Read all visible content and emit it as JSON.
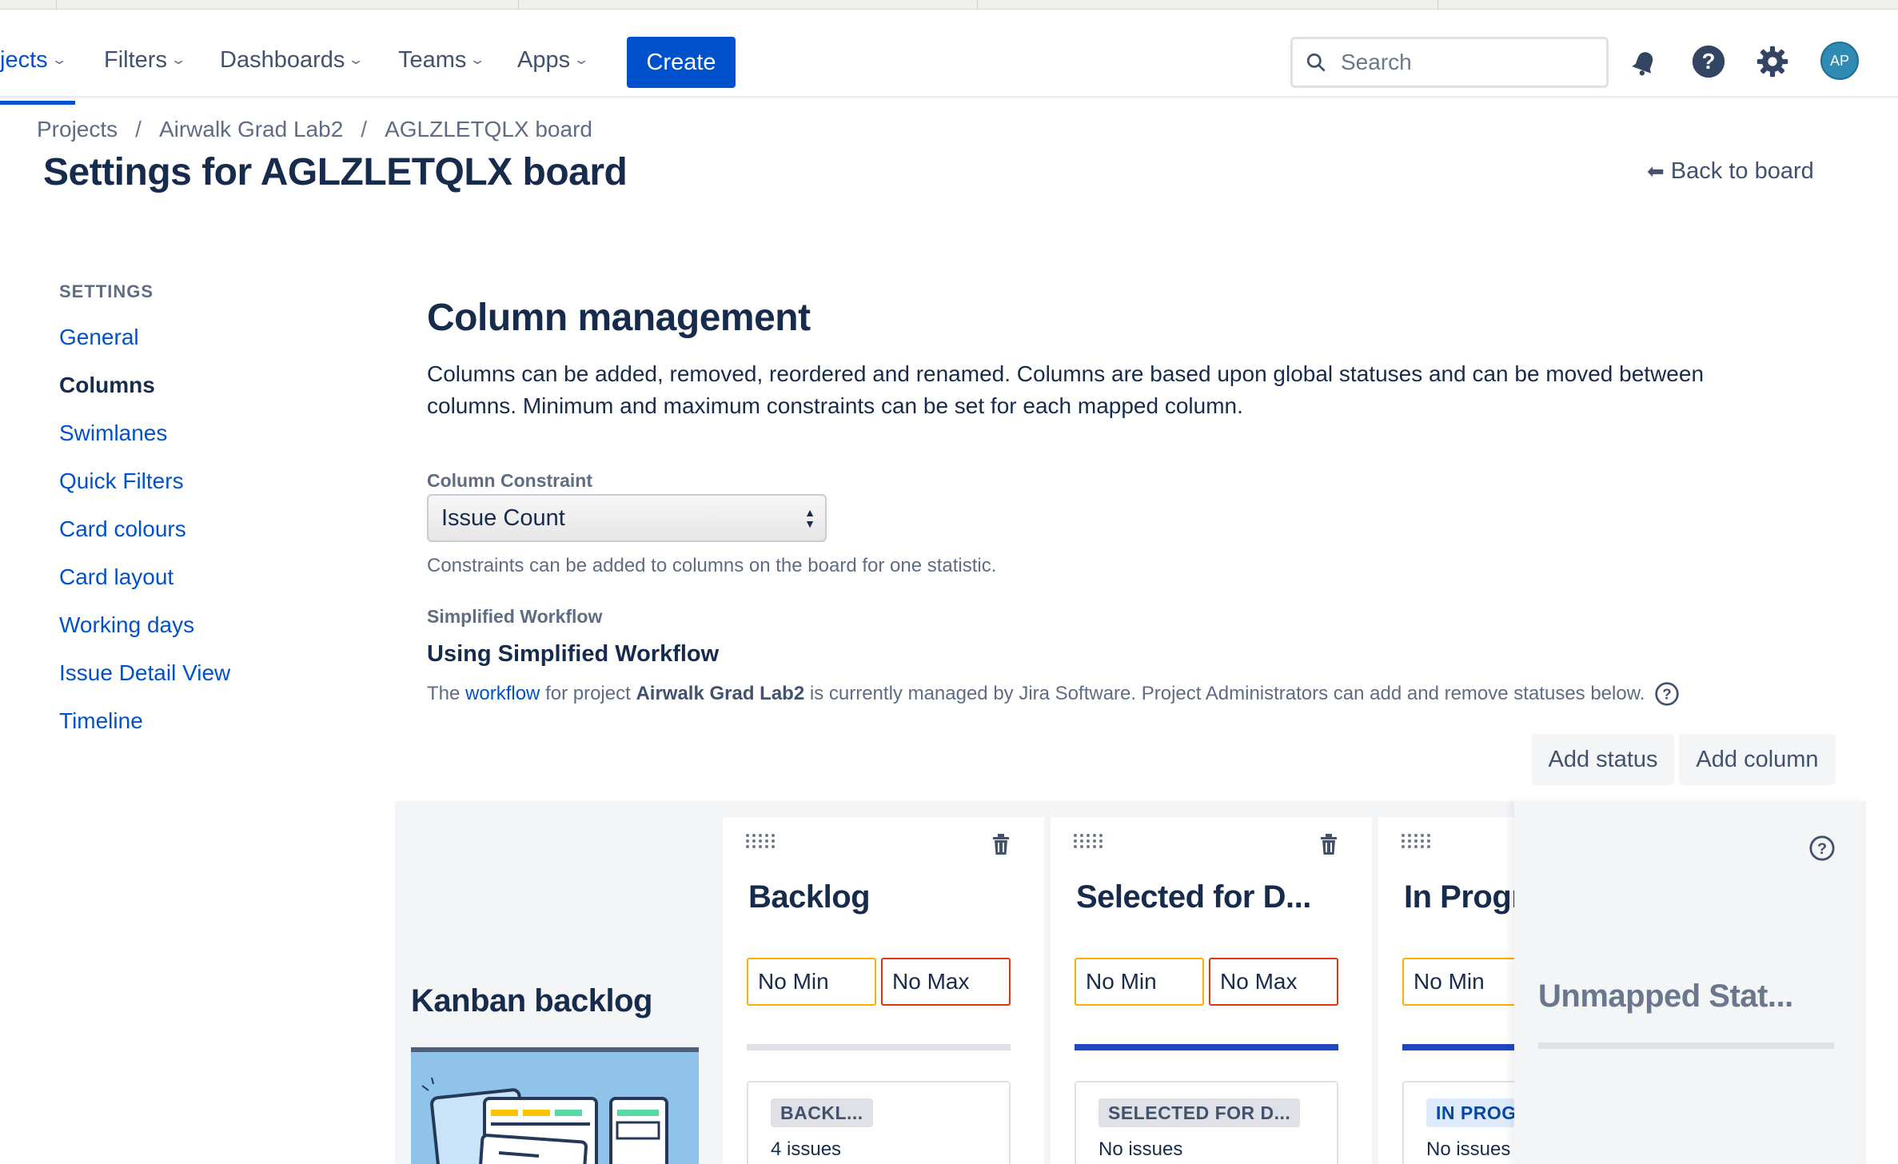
{
  "nav": {
    "items": [
      {
        "label": "jects",
        "active": true
      },
      {
        "label": "Filters"
      },
      {
        "label": "Dashboards"
      },
      {
        "label": "Teams"
      },
      {
        "label": "Apps"
      }
    ],
    "create_label": "Create",
    "search_placeholder": "Search",
    "avatar_initials": "AP",
    "icons": [
      "notification-bell-icon",
      "help-icon",
      "settings-gear-icon"
    ]
  },
  "breadcrumb": [
    "Projects",
    "Airwalk Grad Lab2",
    "AGLZLETQLX board"
  ],
  "page_title": "Settings for AGLZLETQLX board",
  "back_link": "Back to board",
  "sidebar": {
    "heading": "SETTINGS",
    "items": [
      {
        "label": "General"
      },
      {
        "label": "Columns",
        "active": true
      },
      {
        "label": "Swimlanes"
      },
      {
        "label": "Quick Filters"
      },
      {
        "label": "Card colours"
      },
      {
        "label": "Card layout"
      },
      {
        "label": "Working days"
      },
      {
        "label": "Issue Detail View"
      },
      {
        "label": "Timeline"
      }
    ]
  },
  "main": {
    "title": "Column management",
    "description": "Columns can be added, removed, reordered and renamed. Columns are based upon global statuses and can be moved between columns. Minimum and maximum constraints can be set for each mapped column.",
    "constraint_label": "Column Constraint",
    "constraint_value": "Issue Count",
    "constraint_hint": "Constraints can be added to columns on the board for one statistic.",
    "workflow_label": "Simplified Workflow",
    "workflow_title": "Using Simplified Workflow",
    "workflow_text_1": "The",
    "workflow_link": "workflow",
    "workflow_text_2": "for project",
    "workflow_project": "Airwalk Grad Lab2",
    "workflow_text_3": "is currently managed by Jira Software. Project Administrators can add and remove statuses below.",
    "add_status": "Add status",
    "add_column": "Add column"
  },
  "board": {
    "kanban_title": "Kanban backlog",
    "columns": [
      {
        "title": "Backlog",
        "min": "No Min",
        "max": "No Max",
        "status": "BACKL...",
        "issues": "4 issues"
      },
      {
        "title": "Selected for D...",
        "min": "No Min",
        "max": "No Max",
        "status": "SELECTED FOR D...",
        "issues": "No issues"
      },
      {
        "title": "In Progr",
        "min": "No Min",
        "status": "IN PROG",
        "issues": "No issues"
      }
    ],
    "unmapped_title": "Unmapped Stat..."
  },
  "colors": {
    "accent": "#0052cc",
    "text": "#172b4d",
    "min_border": "#ffab00",
    "max_border": "#de350b"
  }
}
